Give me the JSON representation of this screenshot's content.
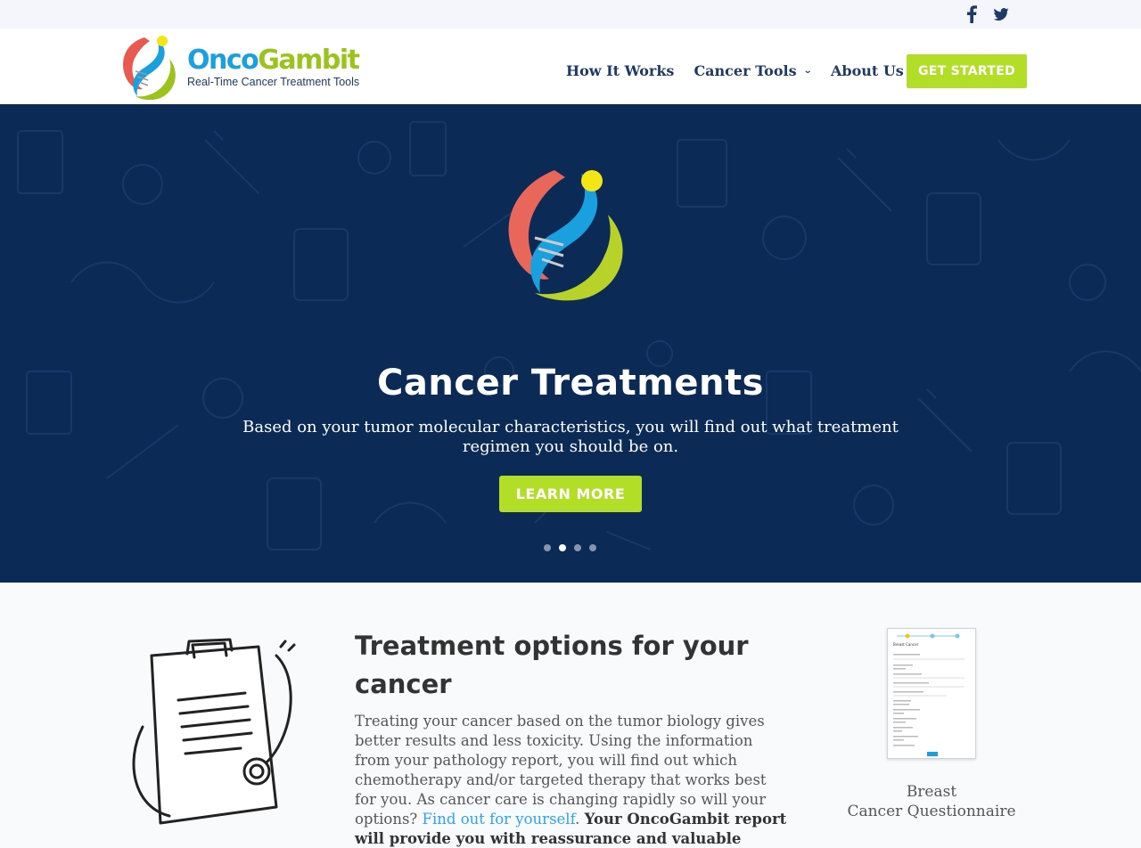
{
  "topbar": {
    "social": [
      {
        "icon": "facebook-icon",
        "color": "#1e3a66"
      },
      {
        "icon": "twitter-icon",
        "color": "#1e3a66"
      }
    ]
  },
  "brand": {
    "name_part1": "Onco",
    "name_part2": "Gambit",
    "tagline": "Real-Time Cancer Treatment Tools",
    "colors": {
      "blue": "#1aa0df",
      "green": "#9cc31c",
      "red": "#e85a4f",
      "yellow": "#f4e515"
    }
  },
  "nav": {
    "items": [
      {
        "label": "How It Works",
        "has_dropdown": false
      },
      {
        "label": "Cancer Tools",
        "has_dropdown": true
      },
      {
        "label": "About Us",
        "has_dropdown": true
      }
    ],
    "dropdown_glyph": "⌄",
    "cta_label": "GET STARTED"
  },
  "hero": {
    "title": "Cancer Treatments",
    "text": "Based on your tumor molecular characteristics, you will find out what treatment regimen you should be on.",
    "button_label": "LEARN MORE",
    "slides_count": 4,
    "active_slide": 2,
    "background_color": "#0c2a56"
  },
  "section": {
    "title": "Treatment options for your cancer",
    "body_text": "Treating your cancer based on the tumor biology gives better results and less toxicity. Using the information from your pathology report, you will find out which chemotherapy and/or targeted therapy that works best for you. As cancer care is changing rapidly so will your options? ",
    "link_text": "Find out for yourself",
    "after_link": ". ",
    "bold_text": "Your OncoGambit report will provide you with reassurance and valuable information:",
    "thumbnail_caption_line1": "Breast",
    "thumbnail_caption_line2": "Cancer Questionnaire",
    "thumbnail_heading": "Breast Cancer"
  },
  "accent_color": "#b2de27",
  "navy_color": "#1e3a66"
}
